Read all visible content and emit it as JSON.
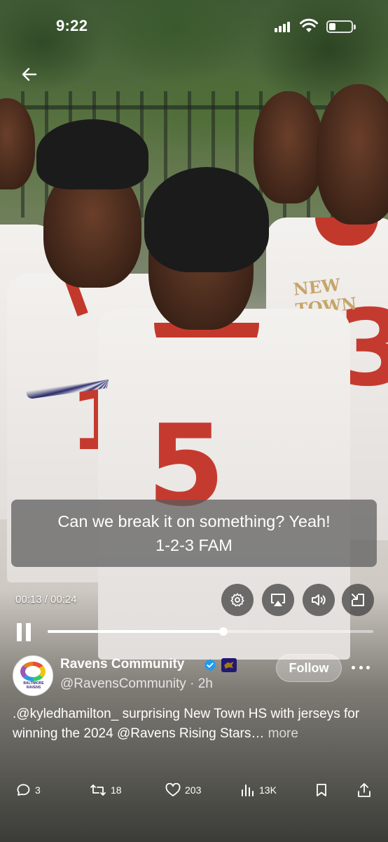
{
  "status_bar": {
    "time": "9:22",
    "battery_level": 0.3
  },
  "video": {
    "caption_lines": [
      "Can we break it on something? Yeah!",
      "1-2-3 FAM"
    ],
    "time_display": "00:13 / 00:24",
    "progress": 0.54
  },
  "controls": {
    "settings_icon": "gear-icon",
    "airplay_icon": "airplay-icon",
    "volume_icon": "speaker-icon",
    "minimize_icon": "minimize-icon"
  },
  "account": {
    "name": "Ravens Community",
    "handle": "@RavensCommunity",
    "time_ago": "2h",
    "avatar_text": "BALTIMORE RAVENS",
    "verified_color": "#1d9bf0",
    "affiliate_color": "#241773",
    "follow_label": "Follow"
  },
  "tweet": {
    "text": ".@kyledhamilton_ surprising New Town HS with jerseys for winning the 2024 @Ravens Rising Stars…",
    "more_label": "more"
  },
  "actions": {
    "replies": "3",
    "reposts": "18",
    "likes": "203",
    "views": "13K"
  },
  "scene": {
    "jersey_text": "NEW TOWN",
    "jersey_numbers": [
      "5",
      "3",
      "1"
    ]
  }
}
